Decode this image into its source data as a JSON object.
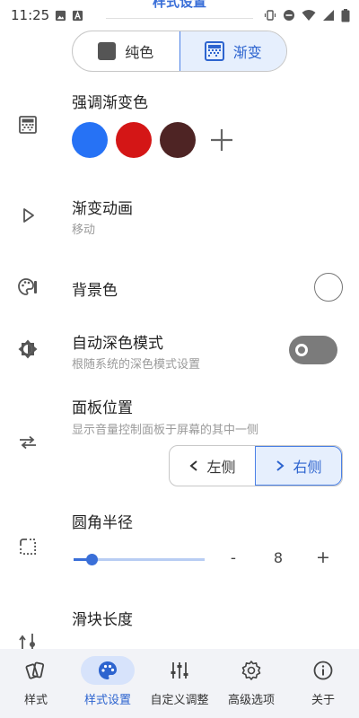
{
  "status_bar": {
    "time": "11:25",
    "icons_left": [
      "image-icon",
      "text-a-icon"
    ],
    "icons_right": [
      "vibrate-icon",
      "dnd-icon",
      "wifi-icon",
      "signal-icon",
      "battery-icon"
    ]
  },
  "header": {
    "title": "样式设置"
  },
  "style_mode": {
    "options": [
      {
        "label": "纯色",
        "icon": "solid-square-icon"
      },
      {
        "label": "渐变",
        "icon": "gradient-square-icon"
      }
    ],
    "selected": "渐变"
  },
  "accent_gradient": {
    "title": "强调渐变色",
    "icon": "gradient-icon",
    "colors": [
      "#2672f5",
      "#d41616",
      "#4e2424"
    ],
    "add_icon": "plus-icon"
  },
  "gradient_animation": {
    "title": "渐变动画",
    "value": "移动",
    "icon": "play-outline-icon"
  },
  "background_color": {
    "title": "背景色",
    "icon": "palette-icon"
  },
  "auto_dark_mode": {
    "title": "自动深色模式",
    "subtitle": "根随系统的深色模式设置",
    "icon": "brightness-icon",
    "enabled": false
  },
  "panel_position": {
    "title": "面板位置",
    "subtitle": "显示音量控制面板于屏幕的其中一侧",
    "icon": "swap-horizontal-icon",
    "options": [
      {
        "label": "左侧",
        "icon": "chevron-left-icon"
      },
      {
        "label": "右侧",
        "icon": "chevron-right-icon"
      }
    ],
    "selected": "右侧"
  },
  "corner_radius": {
    "title": "圆角半径",
    "icon": "rounded-corner-icon",
    "minus": "-",
    "value": "8",
    "plus": "+",
    "slider_fraction": 0.14
  },
  "slider_length": {
    "title": "滑块长度",
    "icon": "height-icon"
  },
  "bottom_nav": {
    "items": [
      {
        "label": "样式",
        "icon": "cards-icon"
      },
      {
        "label": "样式设置",
        "icon": "palette-icon"
      },
      {
        "label": "自定义调整",
        "icon": "sliders-icon"
      },
      {
        "label": "高级选项",
        "icon": "gear-icon"
      },
      {
        "label": "关于",
        "icon": "info-icon"
      }
    ],
    "selected": "样式设置"
  },
  "colors": {
    "accent": "#3a6fd8",
    "selected_bg": "#e6effd",
    "nav_bg": "#f2f3f7"
  }
}
